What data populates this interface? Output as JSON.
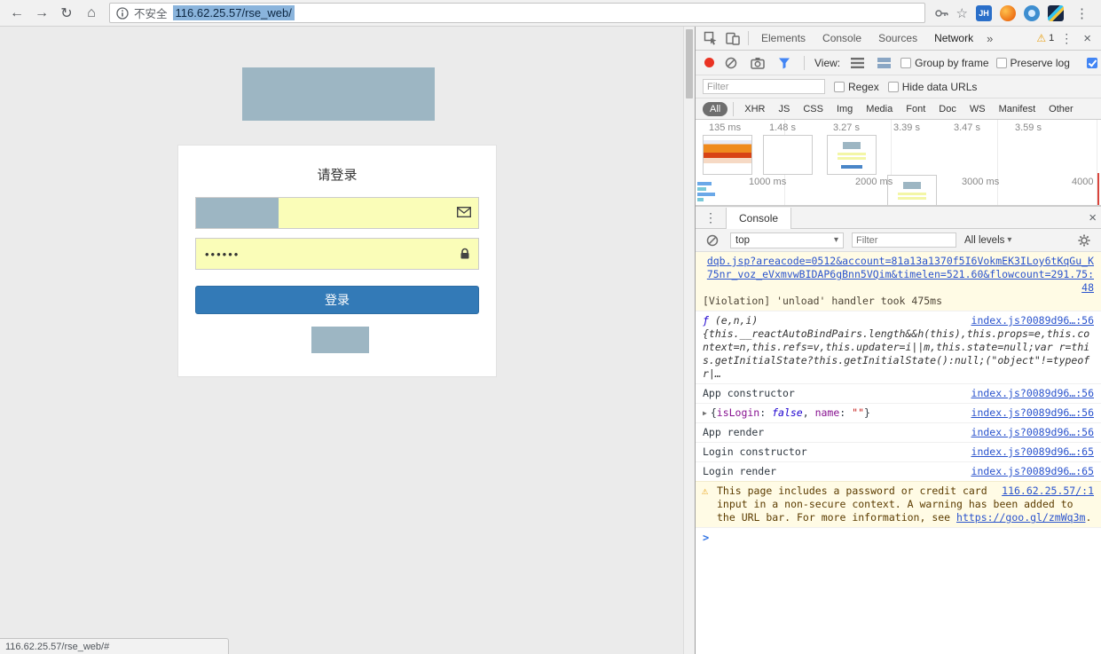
{
  "icons": {
    "back": "←",
    "forward": "→",
    "reload": "↻",
    "home": "⌂",
    "star": "☆",
    "kebab": "⋮",
    "more_chevrons": "»",
    "close": "×",
    "warning": "⚠",
    "caret_down": "▾",
    "expand_caret": "▶",
    "prompt_chevron": ">"
  },
  "browser": {
    "security_label": "不安全",
    "url": "116.62.25.57/rse_web/",
    "status_text": "116.62.25.57/rse_web/#",
    "jh_badge": "JH"
  },
  "page": {
    "login_title": "请登录",
    "password_dots": "••••••",
    "login_button": "登录"
  },
  "devtools": {
    "tabs": {
      "elements": "Elements",
      "console": "Console",
      "sources": "Sources",
      "network": "Network",
      "warning_count": "1"
    },
    "network": {
      "view_label": "View:",
      "group_by_frame": "Group by frame",
      "preserve_log": "Preserve log",
      "filter_placeholder": "Filter",
      "regex_label": "Regex",
      "hide_data_urls_label": "Hide data URLs",
      "pills": [
        "All",
        "XHR",
        "JS",
        "CSS",
        "Img",
        "Media",
        "Font",
        "Doc",
        "WS",
        "Manifest",
        "Other"
      ],
      "frame_times": [
        "135 ms",
        "1.48 s",
        "3.27 s",
        "3.39 s",
        "3.47 s",
        "3.59 s"
      ],
      "grid_labels": [
        "1000 ms",
        "2000 ms",
        "3000 ms",
        "4000"
      ]
    },
    "console": {
      "tab_label": "Console",
      "context": "top",
      "filter_placeholder": "Filter",
      "levels_label": "All levels",
      "violation": {
        "link": "dqb.jsp?areacode=0512&account=81a13a1370f5I6VokmEK3ILoy6tKqGu_K75nr_voz_eVxmvwBIDAP6gBnn5VQim&timelen=521.60&flowcount=291.75:48",
        "text": "[Violation] 'unload' handler took 475ms"
      },
      "fn": {
        "f": "ƒ",
        "args": " (e,n,i)",
        "src": "index.js?0089d96…:56",
        "body": "{this.__reactAutoBindPairs.length&&h(this),this.props=e,this.context=n,this.refs=v,this.updater=i||m,this.state=null;var r=this.getInitialState?this.getInitialState():null;(\"object\"!=typeof r|…"
      },
      "app_ctor": {
        "text": "App constructor",
        "src": "index.js?0089d96…:56"
      },
      "obj": {
        "src": "index.js?0089d96…:56",
        "open": "{",
        "key1": "isLogin",
        "sep1": ": ",
        "val1": "false",
        "comma": ", ",
        "key2": "name",
        "sep2": ": ",
        "val2": "\"\"",
        "close": "}"
      },
      "app_render": {
        "text": "App render",
        "src": "index.js?0089d96…:56"
      },
      "login_ctor": {
        "text": "Login constructor",
        "src": "index.js?0089d96…:65"
      },
      "login_render": {
        "text": "Login render",
        "src": "index.js?0089d96…:65"
      },
      "warn": {
        "text1": "This page includes a password or credit card input in a non-secure context. A warning has been added to the URL bar. For more information, see ",
        "link": "https://goo.gl/zmWq3m",
        "period": ".",
        "src": "116.62.25.57/:1"
      }
    }
  }
}
